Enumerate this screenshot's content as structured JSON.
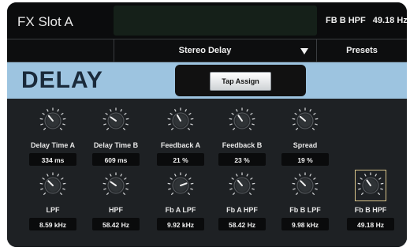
{
  "header": {
    "slot_title": "FX Slot A",
    "readout_param": "FB B HPF",
    "readout_value": "49.18 Hz"
  },
  "selector": {
    "effect_name": "Stereo Delay",
    "presets_label": "Presets"
  },
  "banner": {
    "effect_title": "DELAY",
    "tap_assign_label": "Tap Assign"
  },
  "colors": {
    "banner_bg": "#9dc4e0",
    "selected_frame": "#d8c48a"
  },
  "knobs": [
    {
      "label": "Delay Time A",
      "value": "334 ms"
    },
    {
      "label": "Delay Time B",
      "value": "609 ms"
    },
    {
      "label": "Feedback A",
      "value": "21 %"
    },
    {
      "label": "Feedback B",
      "value": "23 %"
    },
    {
      "label": "Spread",
      "value": "19 %"
    },
    {
      "label": "LPF",
      "value": "8.59 kHz"
    },
    {
      "label": "HPF",
      "value": "58.42 Hz"
    },
    {
      "label": "Fb A LPF",
      "value": "9.92 kHz"
    },
    {
      "label": "Fb A HPF",
      "value": "58.42 Hz"
    },
    {
      "label": "Fb B LPF",
      "value": "9.98 kHz"
    },
    {
      "label": "Fb B HPF",
      "value": "49.18 Hz"
    }
  ]
}
